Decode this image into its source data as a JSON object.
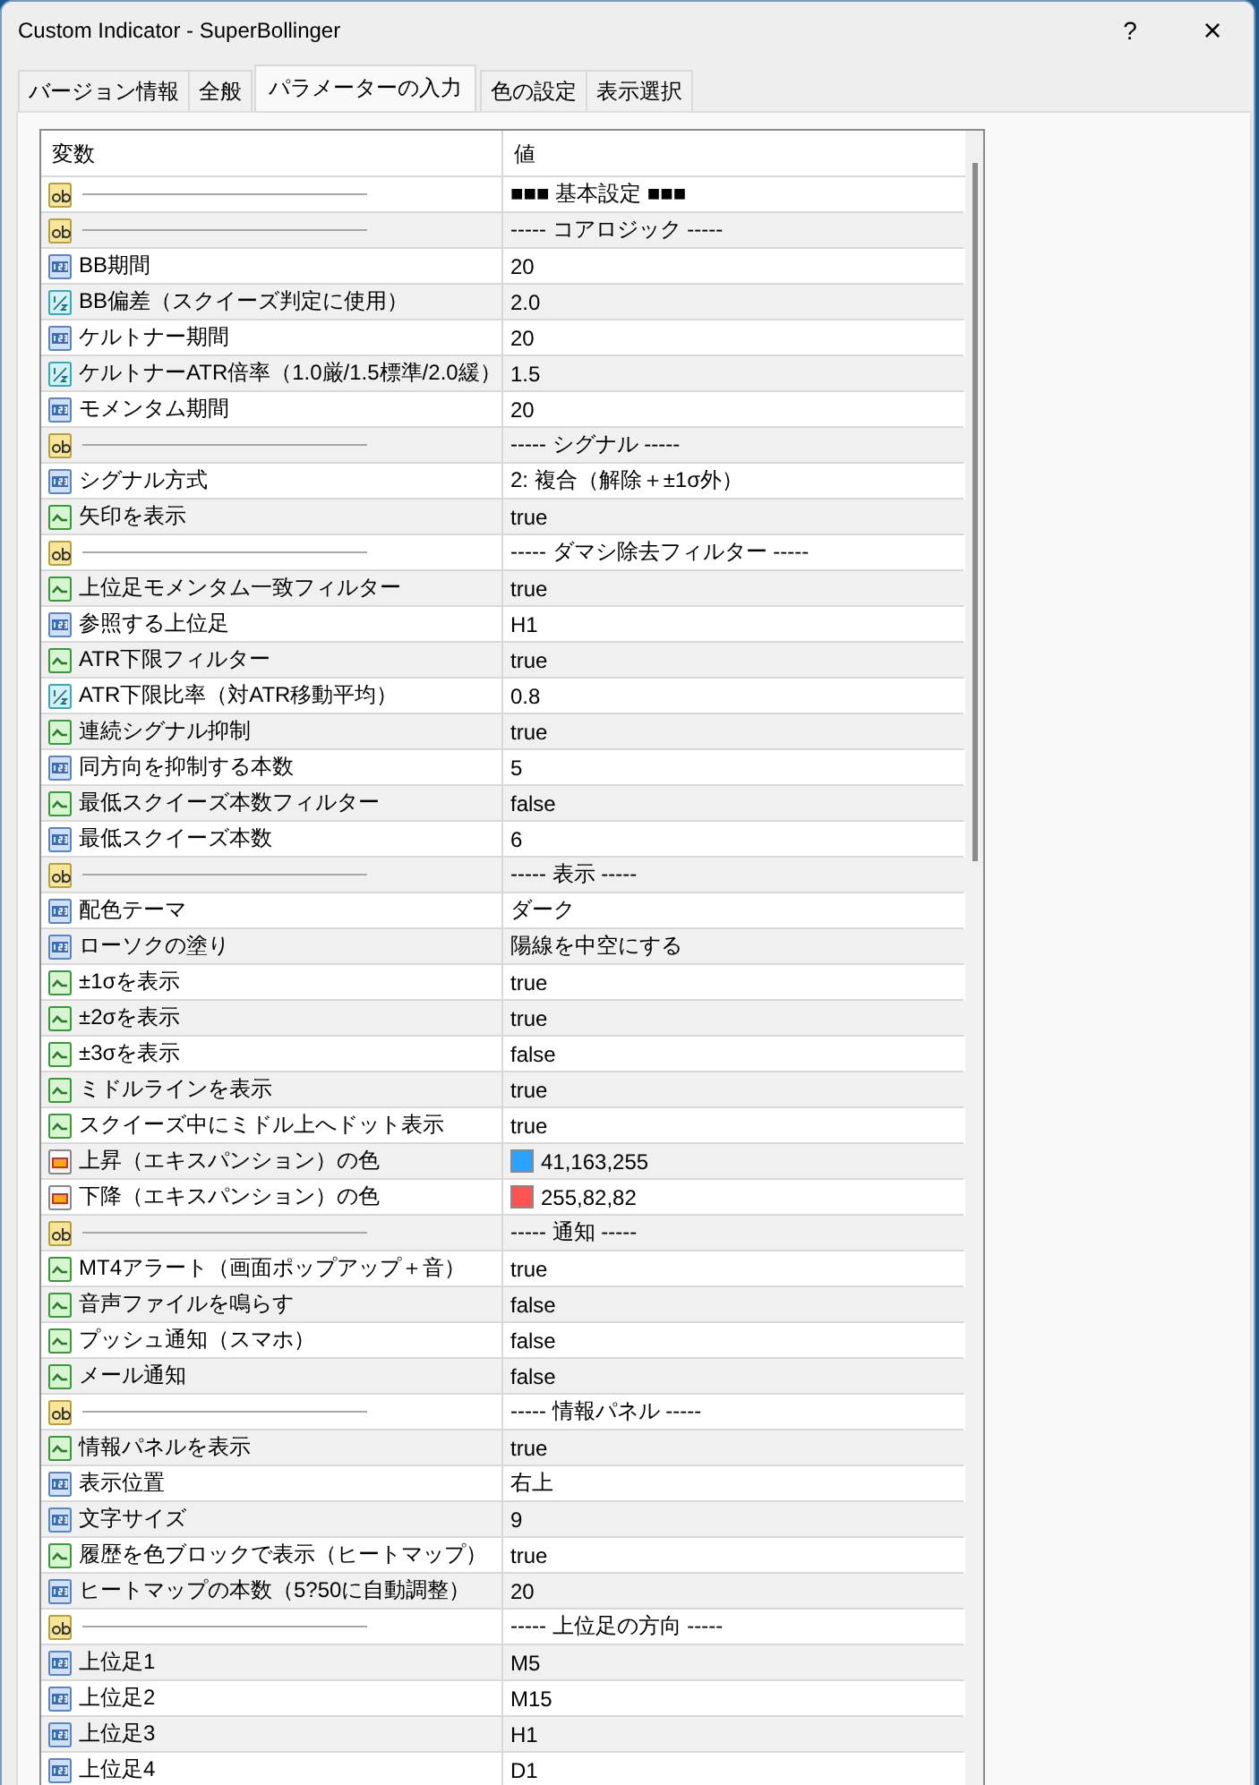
{
  "window": {
    "title": "Custom Indicator - SuperBollinger",
    "buttons": [
      "?",
      "×"
    ]
  },
  "tabs": [
    {
      "label": "バージョン情報",
      "selected": false
    },
    {
      "label": "全般",
      "selected": false
    },
    {
      "label": "パラメーターの入力",
      "selected": true
    },
    {
      "label": "色の設定",
      "selected": false
    },
    {
      "label": "表示選択",
      "selected": false
    }
  ],
  "table": {
    "columns": [
      "変数",
      "値"
    ],
    "rows": [
      {
        "kind": "separator",
        "value": "■■■ 基本設定 ■■■"
      },
      {
        "kind": "separator",
        "value": "----- コアロジック -----"
      },
      {
        "kind": "int",
        "name": "BB期間",
        "value": "20"
      },
      {
        "kind": "double",
        "name": "BB偏差（スクイーズ判定に使用）",
        "value": "2.0"
      },
      {
        "kind": "int",
        "name": "ケルトナー期間",
        "value": "20"
      },
      {
        "kind": "double",
        "name": "ケルトナーATR倍率（1.0厳/1.5標準/2.0緩）",
        "value": "1.5"
      },
      {
        "kind": "int",
        "name": "モメンタム期間",
        "value": "20"
      },
      {
        "kind": "separator",
        "value": "----- シグナル -----"
      },
      {
        "kind": "int",
        "name": "シグナル方式",
        "value": "2: 複合（解除＋±1σ外）"
      },
      {
        "kind": "bool",
        "name": "矢印を表示",
        "value": "true"
      },
      {
        "kind": "separator",
        "value": "----- ダマシ除去フィルター -----"
      },
      {
        "kind": "bool",
        "name": "上位足モメンタム一致フィルター",
        "value": "true"
      },
      {
        "kind": "int",
        "name": "参照する上位足",
        "value": "H1"
      },
      {
        "kind": "bool",
        "name": "ATR下限フィルター",
        "value": "true"
      },
      {
        "kind": "double",
        "name": "ATR下限比率（対ATR移動平均）",
        "value": "0.8"
      },
      {
        "kind": "bool",
        "name": "連続シグナル抑制",
        "value": "true"
      },
      {
        "kind": "int",
        "name": "同方向を抑制する本数",
        "value": "5"
      },
      {
        "kind": "bool",
        "name": "最低スクイーズ本数フィルター",
        "value": "false"
      },
      {
        "kind": "int",
        "name": "最低スクイーズ本数",
        "value": "6"
      },
      {
        "kind": "separator",
        "value": "----- 表示 -----"
      },
      {
        "kind": "int",
        "name": "配色テーマ",
        "value": "ダーク"
      },
      {
        "kind": "int",
        "name": "ローソクの塗り",
        "value": "陽線を中空にする"
      },
      {
        "kind": "bool",
        "name": "±1σを表示",
        "value": "true"
      },
      {
        "kind": "bool",
        "name": "±2σを表示",
        "value": "true"
      },
      {
        "kind": "bool",
        "name": "±3σを表示",
        "value": "false"
      },
      {
        "kind": "bool",
        "name": "ミドルラインを表示",
        "value": "true"
      },
      {
        "kind": "bool",
        "name": "スクイーズ中にミドル上へドット表示",
        "value": "true"
      },
      {
        "kind": "color",
        "name": "上昇（エキスパンション）の色",
        "value": "41,163,255",
        "color": "#29a3ff"
      },
      {
        "kind": "color",
        "name": "下降（エキスパンション）の色",
        "value": "255,82,82",
        "color": "#ff5252"
      },
      {
        "kind": "separator",
        "value": "----- 通知 -----"
      },
      {
        "kind": "bool",
        "name": "MT4アラート（画面ポップアップ＋音）",
        "value": "true"
      },
      {
        "kind": "bool",
        "name": "音声ファイルを鳴らす",
        "value": "false"
      },
      {
        "kind": "bool",
        "name": "プッシュ通知（スマホ）",
        "value": "false"
      },
      {
        "kind": "bool",
        "name": "メール通知",
        "value": "false"
      },
      {
        "kind": "separator",
        "value": "----- 情報パネル -----"
      },
      {
        "kind": "bool",
        "name": "情報パネルを表示",
        "value": "true"
      },
      {
        "kind": "int",
        "name": "表示位置",
        "value": "右上"
      },
      {
        "kind": "int",
        "name": "文字サイズ",
        "value": "9"
      },
      {
        "kind": "bool",
        "name": "履歴を色ブロックで表示（ヒートマップ）",
        "value": "true"
      },
      {
        "kind": "int",
        "name": "ヒートマップの本数（5?50に自動調整）",
        "value": "20"
      },
      {
        "kind": "separator",
        "value": "----- 上位足の方向 -----"
      },
      {
        "kind": "int",
        "name": "上位足1",
        "value": "M5"
      },
      {
        "kind": "int",
        "name": "上位足2",
        "value": "M15"
      },
      {
        "kind": "int",
        "name": "上位足3",
        "value": "H1"
      },
      {
        "kind": "int",
        "name": "上位足4",
        "value": "D1"
      }
    ]
  }
}
